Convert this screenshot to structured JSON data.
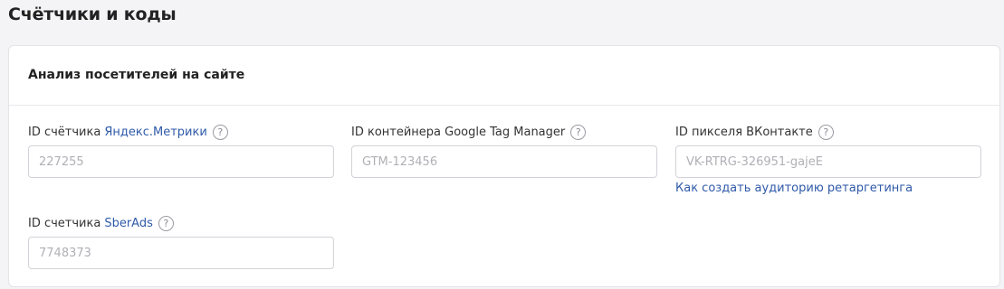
{
  "page": {
    "title": "Счётчики и коды"
  },
  "section": {
    "title": "Анализ посетителей на сайте"
  },
  "fields": {
    "yandex": {
      "label_prefix": "ID счётчика",
      "label_link": "Яндекс.Метрики",
      "help_symbol": "?",
      "placeholder": "227255",
      "value": ""
    },
    "gtm": {
      "label": "ID контейнера Google Tag Manager",
      "help_symbol": "?",
      "placeholder": "GTM-123456",
      "value": ""
    },
    "vk": {
      "label": "ID пикселя ВКонтакте",
      "help_symbol": "?",
      "placeholder": "VK-RTRG-326951-gajeE",
      "value": "",
      "help_link": "Как создать аудиторию ретаргетинга"
    },
    "sberads": {
      "label_prefix": "ID счетчика",
      "label_link": "SberAds",
      "help_symbol": "?",
      "placeholder": "7748373",
      "value": ""
    }
  },
  "colors": {
    "link": "#2f5aa8",
    "background": "#f4f4f6",
    "card": "#ffffff"
  }
}
